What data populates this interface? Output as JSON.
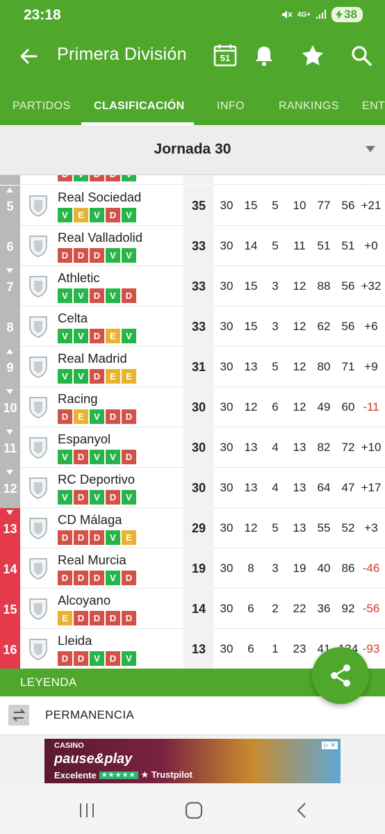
{
  "status": {
    "time": "23:18",
    "network": "4G+",
    "battery": "38"
  },
  "header": {
    "title": "Primera División",
    "calendar_day": "51"
  },
  "tabs": [
    {
      "label": "PARTIDOS",
      "active": false
    },
    {
      "label": "CLASIFICACIÓN",
      "active": true
    },
    {
      "label": "INFO",
      "active": false
    },
    {
      "label": "RANKINGS",
      "active": false
    },
    {
      "label": "ENT",
      "active": false
    }
  ],
  "round": {
    "label": "Jornada 30"
  },
  "partial_row_form": [
    "D",
    "V",
    "D",
    "D",
    "V"
  ],
  "standings": [
    {
      "pos": "5",
      "trend": "up",
      "zone": "gray",
      "team": "Real Sociedad",
      "form": [
        "V",
        "E",
        "V",
        "D",
        "V"
      ],
      "pts": "35",
      "pj": "30",
      "g": "15",
      "e": "5",
      "p": "10",
      "gf": "77",
      "gc": "56",
      "dif": "+21"
    },
    {
      "pos": "6",
      "trend": "",
      "zone": "gray",
      "team": "Real Valladolid",
      "form": [
        "D",
        "D",
        "D",
        "V",
        "V"
      ],
      "pts": "33",
      "pj": "30",
      "g": "14",
      "e": "5",
      "p": "11",
      "gf": "51",
      "gc": "51",
      "dif": "+0"
    },
    {
      "pos": "7",
      "trend": "down",
      "zone": "gray",
      "team": "Athletic",
      "form": [
        "V",
        "V",
        "D",
        "V",
        "D"
      ],
      "pts": "33",
      "pj": "30",
      "g": "15",
      "e": "3",
      "p": "12",
      "gf": "88",
      "gc": "56",
      "dif": "+32"
    },
    {
      "pos": "8",
      "trend": "",
      "zone": "gray",
      "team": "Celta",
      "form": [
        "V",
        "V",
        "D",
        "E",
        "V"
      ],
      "pts": "33",
      "pj": "30",
      "g": "15",
      "e": "3",
      "p": "12",
      "gf": "62",
      "gc": "56",
      "dif": "+6"
    },
    {
      "pos": "9",
      "trend": "up",
      "zone": "gray",
      "team": "Real Madrid",
      "form": [
        "V",
        "V",
        "D",
        "E",
        "E"
      ],
      "pts": "31",
      "pj": "30",
      "g": "13",
      "e": "5",
      "p": "12",
      "gf": "80",
      "gc": "71",
      "dif": "+9"
    },
    {
      "pos": "10",
      "trend": "down",
      "zone": "gray",
      "team": "Racing",
      "form": [
        "D",
        "E",
        "V",
        "D",
        "D"
      ],
      "pts": "30",
      "pj": "30",
      "g": "12",
      "e": "6",
      "p": "12",
      "gf": "49",
      "gc": "60",
      "dif": "-11"
    },
    {
      "pos": "11",
      "trend": "down",
      "zone": "gray",
      "team": "Espanyol",
      "form": [
        "V",
        "D",
        "V",
        "V",
        "D"
      ],
      "pts": "30",
      "pj": "30",
      "g": "13",
      "e": "4",
      "p": "13",
      "gf": "82",
      "gc": "72",
      "dif": "+10"
    },
    {
      "pos": "12",
      "trend": "down",
      "zone": "gray",
      "team": "RC Deportivo",
      "form": [
        "V",
        "D",
        "V",
        "D",
        "V"
      ],
      "pts": "30",
      "pj": "30",
      "g": "13",
      "e": "4",
      "p": "13",
      "gf": "64",
      "gc": "47",
      "dif": "+17"
    },
    {
      "pos": "13",
      "trend": "down",
      "zone": "red",
      "team": "CD Málaga",
      "form": [
        "D",
        "D",
        "D",
        "V",
        "E"
      ],
      "pts": "29",
      "pj": "30",
      "g": "12",
      "e": "5",
      "p": "13",
      "gf": "55",
      "gc": "52",
      "dif": "+3"
    },
    {
      "pos": "14",
      "trend": "",
      "zone": "red",
      "team": "Real Murcia",
      "form": [
        "D",
        "D",
        "D",
        "V",
        "D"
      ],
      "pts": "19",
      "pj": "30",
      "g": "8",
      "e": "3",
      "p": "19",
      "gf": "40",
      "gc": "86",
      "dif": "-46"
    },
    {
      "pos": "15",
      "trend": "",
      "zone": "red",
      "team": "Alcoyano",
      "form": [
        "E",
        "D",
        "D",
        "D",
        "D"
      ],
      "pts": "14",
      "pj": "30",
      "g": "6",
      "e": "2",
      "p": "22",
      "gf": "36",
      "gc": "92",
      "dif": "-56"
    },
    {
      "pos": "16",
      "trend": "",
      "zone": "red",
      "team": "Lleida",
      "form": [
        "D",
        "D",
        "V",
        "D",
        "V"
      ],
      "pts": "13",
      "pj": "30",
      "g": "6",
      "e": "1",
      "p": "23",
      "gf": "41",
      "gc": "134",
      "dif": "-93"
    }
  ],
  "legend": {
    "header": "LEYENDA",
    "items": [
      {
        "label": "PERMANENCIA"
      }
    ]
  },
  "ad": {
    "casino": "CASINO",
    "brand": "pause&play",
    "rating_text": "Excelente",
    "stars": "★★★★★",
    "trustpilot": "★ Trustpilot",
    "adchoice": "▷ ✕"
  },
  "colors": {
    "brand_green": "#4fa82b",
    "win": "#27b54a",
    "loss": "#d35147",
    "draw": "#e8b330",
    "relegation": "#e43a4b",
    "neutral_zone": "#b9b9b9"
  },
  "icons": [
    "back-arrow-icon",
    "calendar-icon",
    "bell-icon",
    "star-icon",
    "search-icon",
    "caret-down-icon",
    "share-icon",
    "swap-icon",
    "recents-icon",
    "home-icon",
    "back-icon"
  ]
}
